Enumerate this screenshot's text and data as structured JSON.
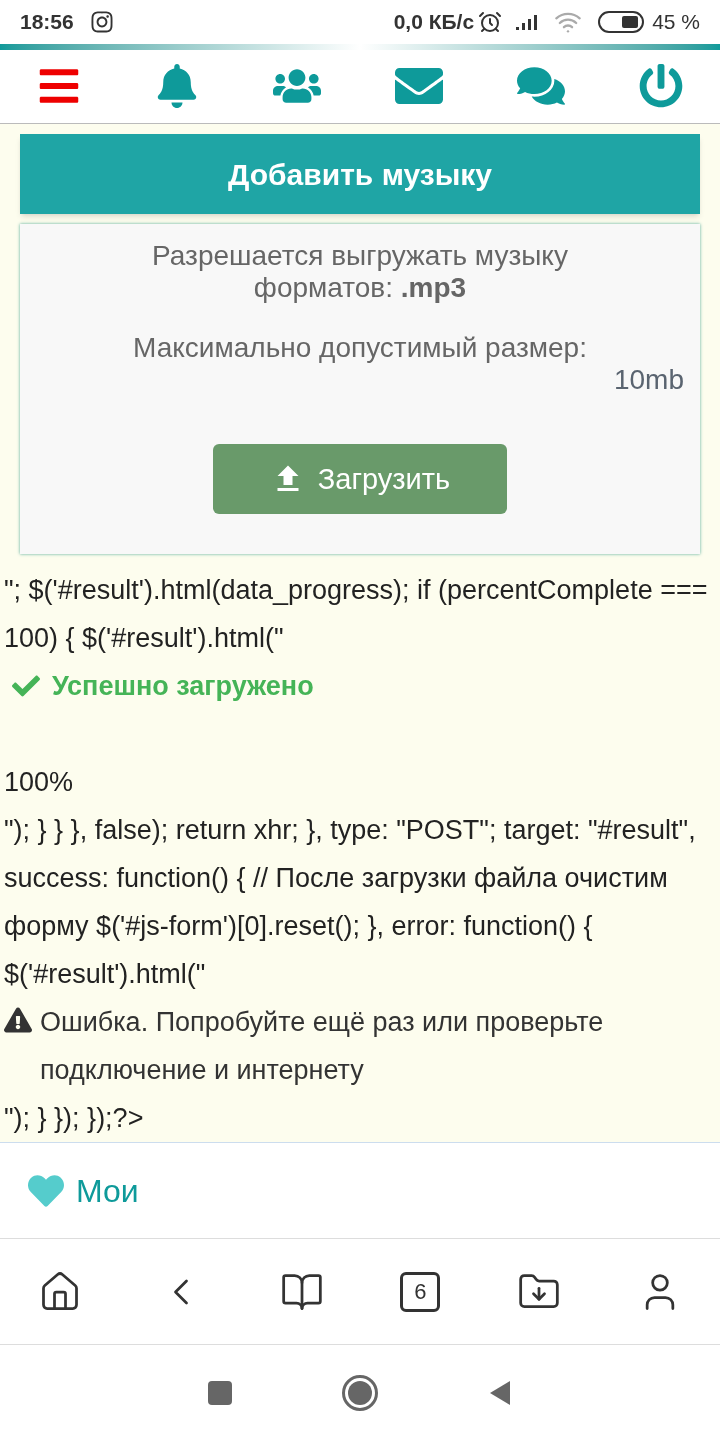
{
  "status_bar": {
    "time": "18:56",
    "speed": "0,0 КБ/с",
    "battery": "45 %"
  },
  "upload": {
    "title": "Добавить музыку",
    "formats": "Разрешается выгружать музыку форматов: **.mp3**",
    "max_label": "Максимально допустимый размер:",
    "max_value": "10mb",
    "button": "Загрузить"
  },
  "output": [
    {
      "kind": "code",
      "text": "\"; $('#result').html(data_progress); if (percentComplete === 100) { $('#result').html(\""
    },
    {
      "kind": "success",
      "text": "Успешно загружено"
    },
    {
      "kind": "gap"
    },
    {
      "kind": "code",
      "text": "100%"
    },
    {
      "kind": "code",
      "text": "\"); } } }, false); return xhr; }, type: \"POST\"; target: \"#result\", success: function() { // После загрузки файла очистим форму $('#js-form')[0].reset(); }, error: function() { $('#result').html(\""
    },
    {
      "kind": "warning",
      "text": "Ошибка. Попробуйте ещё раз или проверьте подключение и интернету"
    },
    {
      "kind": "code",
      "text": "\"); } }); });?>"
    }
  ],
  "footer": {
    "link": "Мои"
  },
  "browser_bar": {
    "tab_count": "6"
  }
}
